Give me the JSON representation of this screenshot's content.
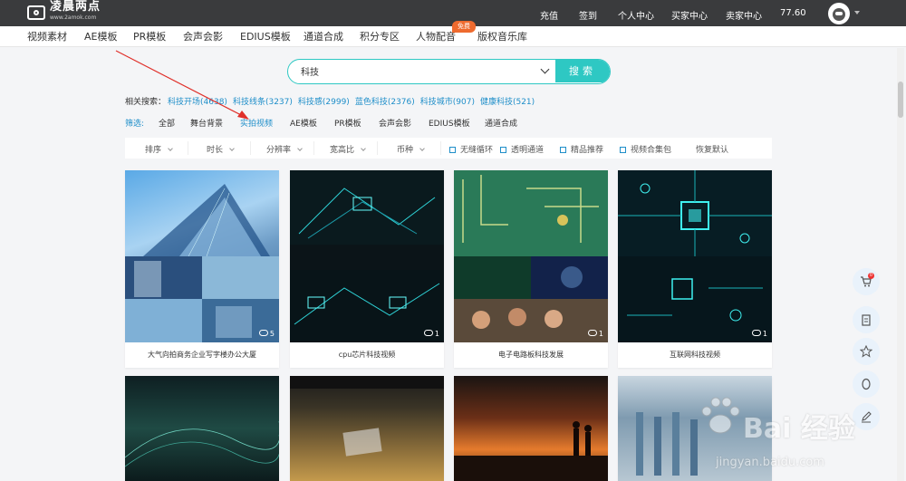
{
  "brand": {
    "name": "凌晨两点",
    "url": "www.2amok.com"
  },
  "topbar": {
    "links": [
      "充值",
      "签到",
      "个人中心",
      "买家中心",
      "卖家中心"
    ],
    "balance": "77.60"
  },
  "nav": {
    "items": [
      "视频素材",
      "AE模板",
      "PR模板",
      "会声会影",
      "EDIUS模板",
      "通道合成",
      "积分专区",
      "人物配音",
      "版权音乐库"
    ],
    "badge": "免费"
  },
  "search": {
    "value": "科技",
    "button": "搜索"
  },
  "related": {
    "label": "相关搜索：",
    "items": [
      "科技开场(4638)",
      "科技线条(3237)",
      "科技感(2999)",
      "蓝色科技(2376)",
      "科技城市(907)",
      "健康科技(521)"
    ]
  },
  "filter": {
    "label": "筛选:",
    "options": [
      "全部",
      "舞台背景",
      "实拍视频",
      "AE模板",
      "PR模板",
      "会声会影",
      "EDIUS模板",
      "通道合成"
    ],
    "active": "实拍视频"
  },
  "sortbar": {
    "dropdowns": [
      "排序",
      "时长",
      "分辨率",
      "宽高比",
      "币种"
    ],
    "checks": [
      "无缝循环",
      "透明通道",
      "精品推荐",
      "视频合集包"
    ],
    "reset": "恢复默认"
  },
  "cards": [
    {
      "title": "大气向拍商务企业写字楼办公大厦",
      "count": "5"
    },
    {
      "title": "cpu芯片科技视频",
      "count": "1"
    },
    {
      "title": "电子电路板科技发展",
      "count": "1"
    },
    {
      "title": "互联网科技视频",
      "count": "1"
    },
    {
      "title": "",
      "count": ""
    },
    {
      "title": "",
      "count": ""
    },
    {
      "title": "",
      "count": ""
    },
    {
      "title": "",
      "count": ""
    }
  ],
  "side": {
    "cart_count": "0"
  },
  "watermark": {
    "text": "Bai 经验",
    "url": "jingyan.baidu.com"
  },
  "colors": {
    "accent": "#2ec8c3",
    "link": "#1e8ec9",
    "topbar": "#3a3b3d",
    "badge": "#ee6a2e"
  }
}
